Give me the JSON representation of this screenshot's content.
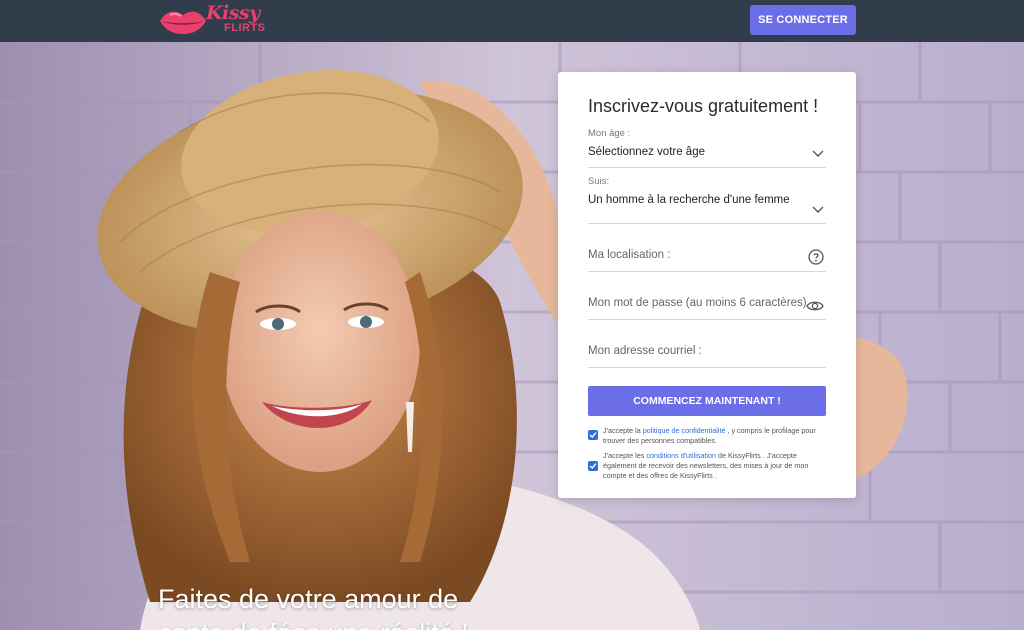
{
  "header": {
    "logo_kissy": "Kissy",
    "logo_flirts": "FLIRTS",
    "login_button": "SE CONNECTER"
  },
  "hero": {
    "tagline_line1": "Faites de votre amour de",
    "tagline_line2": "conte de fées une réalité !"
  },
  "form": {
    "title": "Inscrivez-vous gratuitement !",
    "age": {
      "label": "Mon âge :",
      "value": "Sélectionnez votre âge"
    },
    "seeking": {
      "label": "Suis:",
      "value": "Un homme à la recherche d'une femme"
    },
    "location": {
      "placeholder": "Ma localisation :"
    },
    "password": {
      "placeholder": "Mon mot de passe (au moins 6 caractères)"
    },
    "email": {
      "placeholder": "Mon adresse courriel :"
    },
    "submit": "COMMENCEZ MAINTENANT !",
    "consent1": {
      "before": "J'accepte la ",
      "link": "politique de confidentialité",
      "after": " , y compris le profilage pour trouver des personnes compatibles."
    },
    "consent2": {
      "before": "J'accepte les ",
      "link": "conditions d'utilisation",
      "after": " de KissyFlirts . J'accepte également de recevoir des newsletters, des mises à jour de mon compte et des offres de KissyFlirts ."
    }
  },
  "colors": {
    "header_bg": "#323d4b",
    "accent": "#6c6ee8",
    "brand": "#e8416e",
    "link": "#2e6fd6"
  },
  "icons": [
    "lips-logo-icon",
    "chevron-down-icon",
    "help-circle-icon",
    "eye-icon",
    "checkbox-checked-icon"
  ]
}
